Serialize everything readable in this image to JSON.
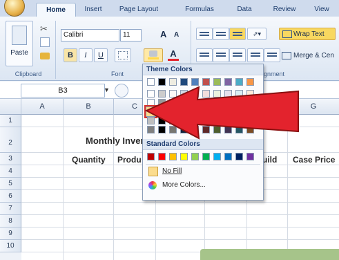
{
  "ribbon": {
    "tabs": [
      "Home",
      "Insert",
      "Page Layout",
      "Formulas",
      "Data",
      "Review",
      "View"
    ],
    "active_tab": "Home",
    "paste_label": "Paste",
    "font_name": "Calibri",
    "font_size": "11",
    "grow_font": "A",
    "shrink_font": "A",
    "bold": "B",
    "italic": "I",
    "underline": "U",
    "font_color_letter": "A",
    "wrap_text": "Wrap Text",
    "merge_center": "Merge & Cen",
    "groups": {
      "clipboard": "Clipboard",
      "font": "Font",
      "alignment": "Alignment"
    }
  },
  "formula_bar": {
    "name_box": "B3"
  },
  "sheet": {
    "columns": [
      "A",
      "B",
      "C",
      "",
      "",
      "",
      "G"
    ],
    "rows": [
      "1",
      "2",
      "3",
      "4",
      "5",
      "6",
      "7",
      "8",
      "9",
      "10"
    ],
    "cells": {
      "title": "Monthly Inver",
      "quantity": "Quantity",
      "product": "Produ",
      "build": "uild",
      "case_price": "Case Price"
    }
  },
  "dropdown": {
    "theme_colors_label": "Theme Colors",
    "standard_colors_label": "Standard Colors",
    "no_fill_label": "No Fill",
    "more_colors_label": "More Colors...",
    "theme_top_row": [
      "#ffffff",
      "#000000",
      "#eeece1",
      "#1f497d",
      "#4f81bd",
      "#c0504d",
      "#9bbb59",
      "#8064a2",
      "#4bacc6",
      "#f79646"
    ],
    "standard_colors": [
      "#c00000",
      "#ff0000",
      "#ffc000",
      "#ffff00",
      "#92d050",
      "#00b050",
      "#00b0f0",
      "#0070c0",
      "#002060",
      "#7030a0"
    ]
  },
  "colors": {
    "arrow": "#e3232d",
    "selection_highlight": "#d9302a",
    "highlight_fill": "#fbdc8d"
  }
}
